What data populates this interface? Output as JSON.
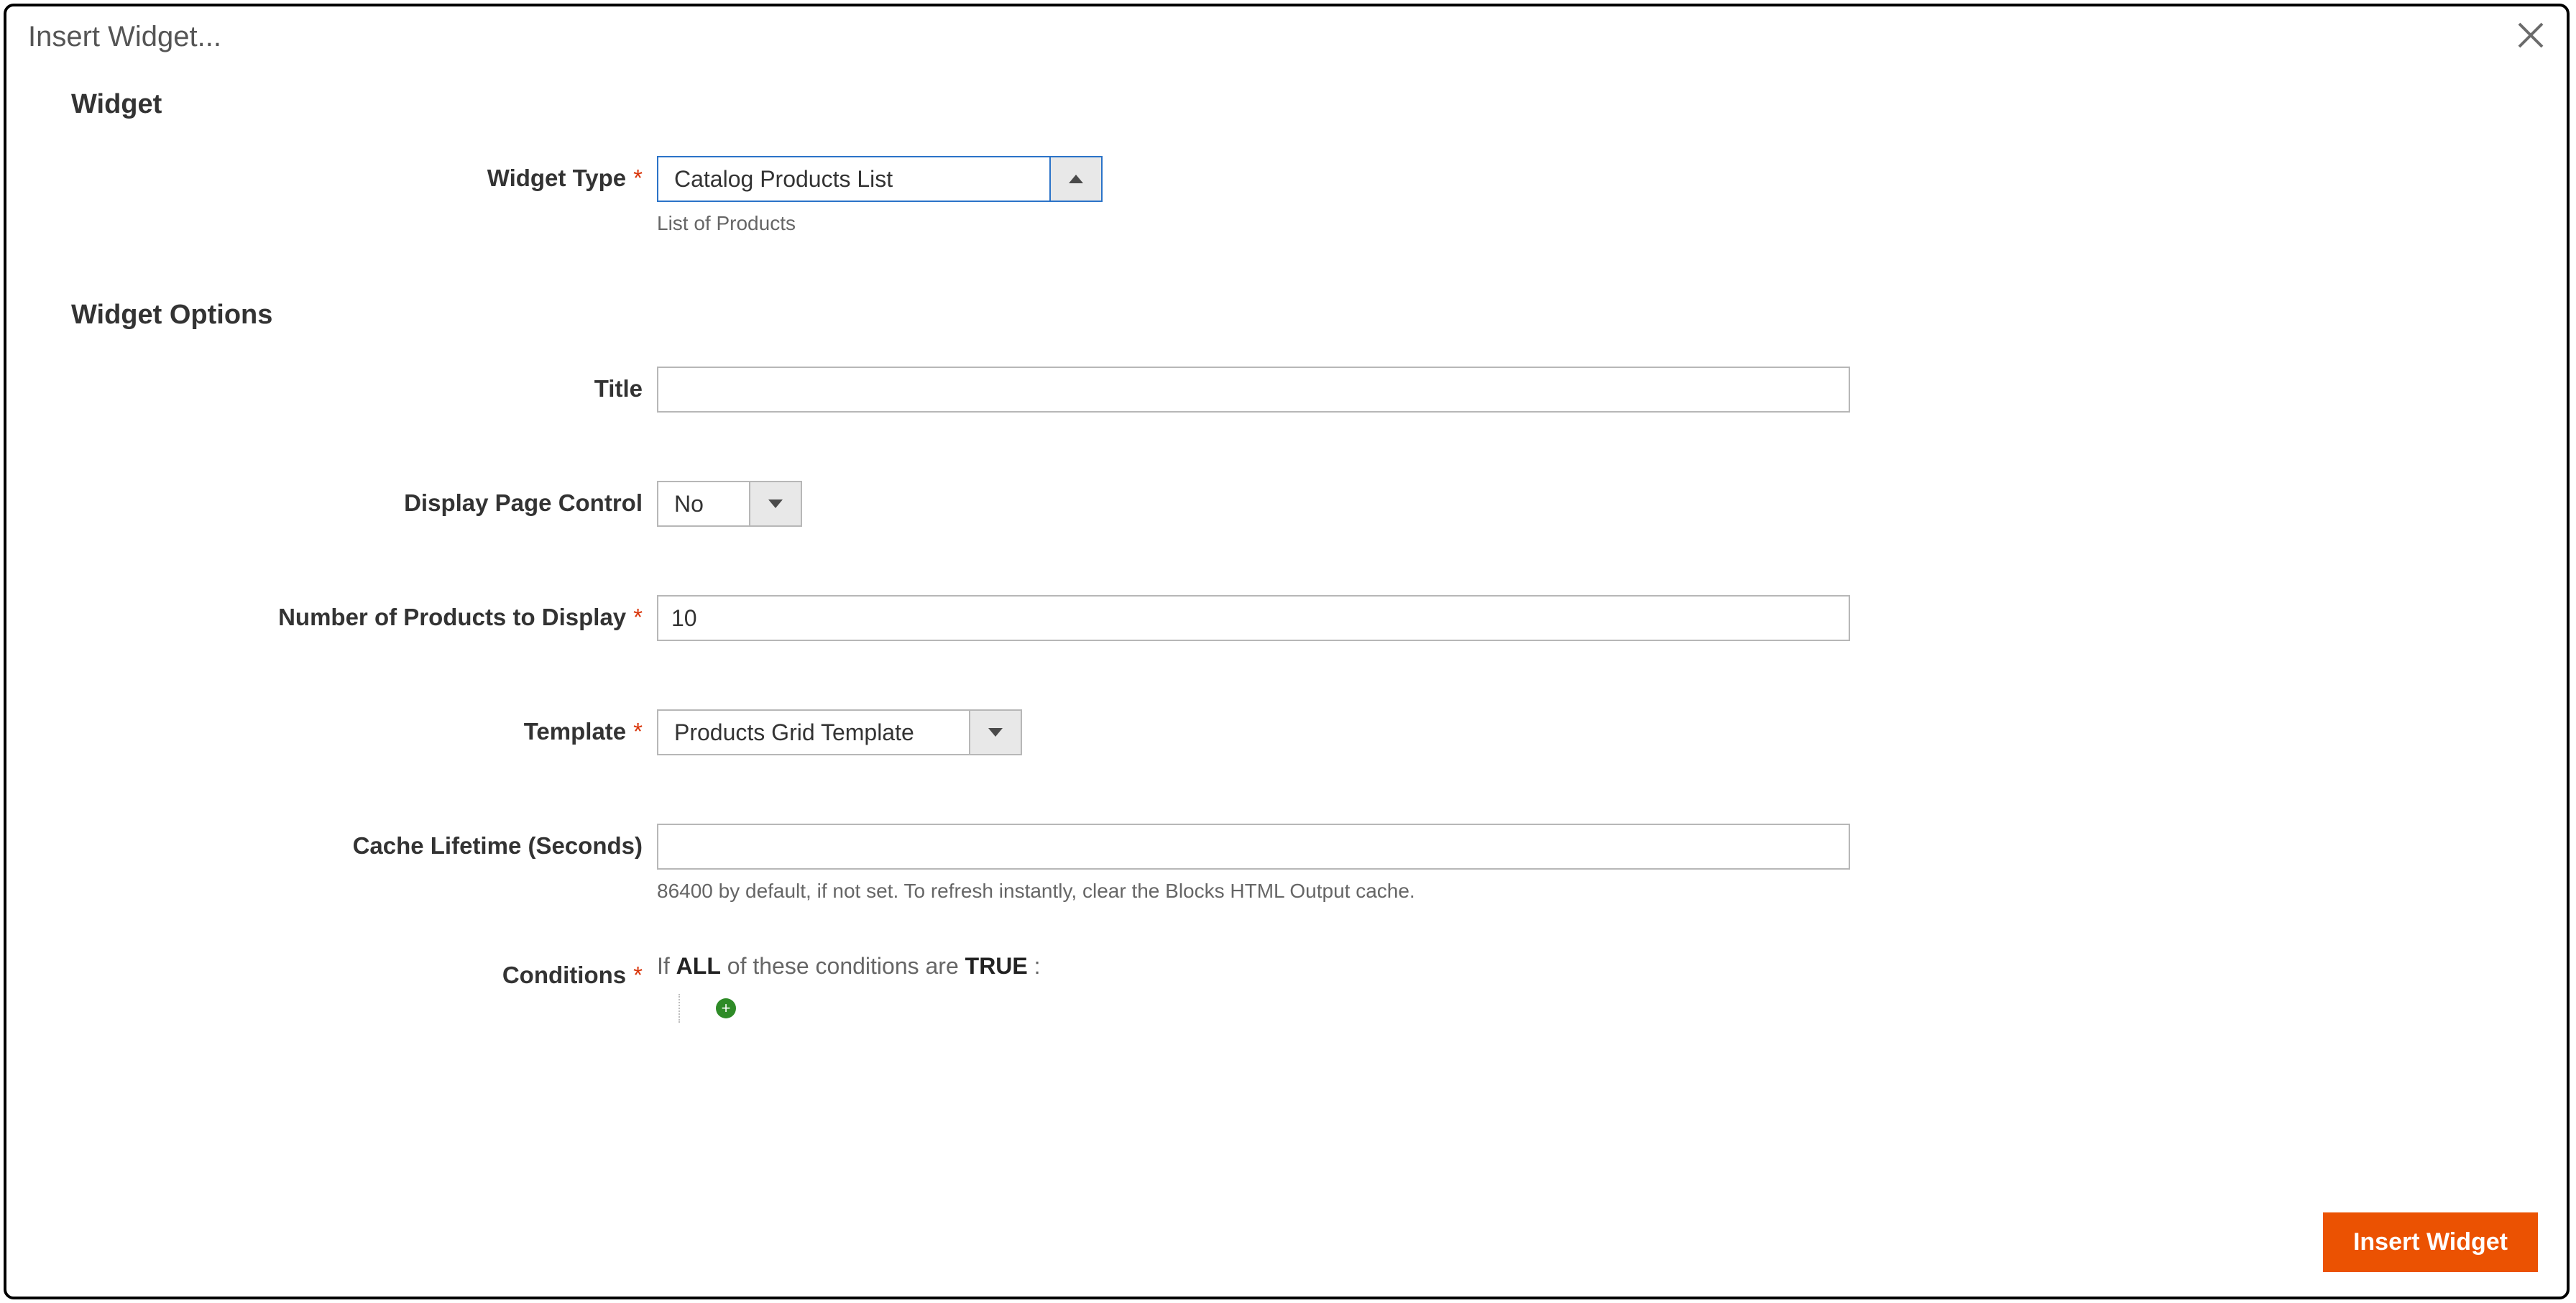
{
  "modal": {
    "title": "Insert Widget...",
    "section_widget": "Widget",
    "section_options": "Widget Options"
  },
  "widget_type": {
    "label": "Widget Type",
    "value": "Catalog Products List",
    "hint": "List of Products"
  },
  "title_field": {
    "label": "Title",
    "value": ""
  },
  "display_page_control": {
    "label": "Display Page Control",
    "value": "No"
  },
  "num_products": {
    "label": "Number of Products to Display",
    "value": "10"
  },
  "template": {
    "label": "Template",
    "value": "Products Grid Template"
  },
  "cache": {
    "label": "Cache Lifetime (Seconds)",
    "value": "",
    "hint": "86400 by default, if not set. To refresh instantly, clear the Blocks HTML Output cache."
  },
  "conditions": {
    "label": "Conditions",
    "prefix": "If ",
    "agg": "ALL",
    "mid": " of these conditions are ",
    "val": "TRUE",
    "suffix": " :"
  },
  "footer": {
    "insert": "Insert Widget"
  }
}
